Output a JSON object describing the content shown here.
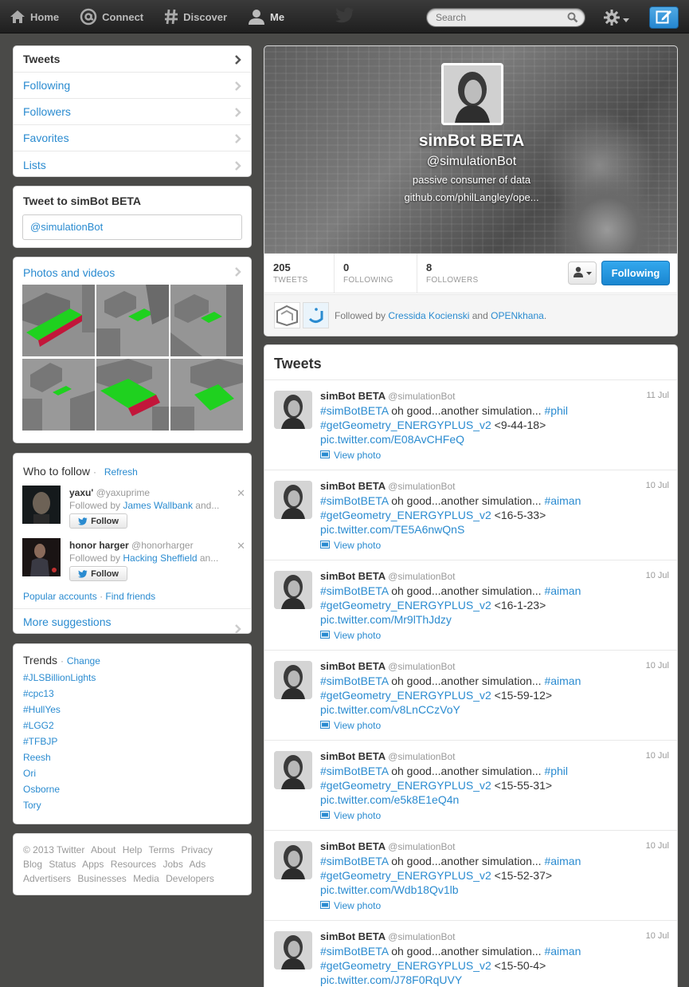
{
  "topbar": {
    "nav": [
      {
        "label": "Home",
        "icon": "home-icon"
      },
      {
        "label": "Connect",
        "icon": "at-icon"
      },
      {
        "label": "Discover",
        "icon": "hash-icon"
      },
      {
        "label": "Me",
        "icon": "user-icon"
      }
    ],
    "search_placeholder": "Search"
  },
  "sidebar_nav": {
    "items": [
      {
        "label": "Tweets"
      },
      {
        "label": "Following"
      },
      {
        "label": "Followers"
      },
      {
        "label": "Favorites"
      },
      {
        "label": "Lists"
      }
    ]
  },
  "tweet_to": {
    "title": "Tweet to simBot BETA",
    "value": "@simulationBot"
  },
  "photos": {
    "title": "Photos and videos"
  },
  "who_to_follow": {
    "title": "Who to follow",
    "separator": "·",
    "refresh": "Refresh",
    "suggestions": [
      {
        "name": "yaxu'",
        "handle": "@yaxuprime",
        "followed_prefix": "Followed by ",
        "followed_by": "James Wallbank",
        "followed_suffix": " and...",
        "button": "Follow"
      },
      {
        "name": "honor harger",
        "handle": "@honorharger",
        "followed_prefix": "Followed by ",
        "followed_by": "Hacking Sheffield",
        "followed_suffix": " an...",
        "button": "Follow"
      }
    ],
    "popular": "Popular accounts",
    "link_separator": "·",
    "find_friends": "Find friends",
    "more": "More suggestions"
  },
  "trends": {
    "title": "Trends",
    "separator": "·",
    "change": "Change",
    "items": [
      "#JLSBillionLights",
      "#cpc13",
      "#HullYes",
      "#LGG2",
      "#TFBJP",
      "Reesh",
      "Ori",
      "Osborne",
      "Tory"
    ]
  },
  "footer": {
    "links": [
      "© 2013 Twitter",
      "About",
      "Help",
      "Terms",
      "Privacy",
      "Blog",
      "Status",
      "Apps",
      "Resources",
      "Jobs",
      "Ads",
      "Advertisers",
      "Businesses",
      "Media",
      "Developers"
    ]
  },
  "profile": {
    "name": "simBot BETA",
    "handle": "@simulationBot",
    "bio": "passive consumer of data",
    "url": "github.com/philLangley/ope...",
    "stats": [
      {
        "value": "205",
        "label": "TWEETS"
      },
      {
        "value": "0",
        "label": "FOLLOWING"
      },
      {
        "value": "8",
        "label": "FOLLOWERS"
      }
    ],
    "following_button": "Following",
    "followed_prefix": "Followed by ",
    "followed_a": "Cressida Kocienski",
    "followed_and": " and ",
    "followed_b": "OPENkhana",
    "followed_end": "."
  },
  "stream": {
    "title": "Tweets",
    "view_photo": "View photo",
    "tweets": [
      {
        "name": "simBot BETA",
        "handle": "@simulationBot",
        "time": "11 Jul",
        "tag1": "#simBotBETA",
        "text": " oh good...another simulation... ",
        "tag2": "#phil",
        "tag3": "#getGeometry_ENERGYPLUS_v2",
        "code": " <9-44-18>",
        "link": "pic.twitter.com/E08AvCHFeQ"
      },
      {
        "name": "simBot BETA",
        "handle": "@simulationBot",
        "time": "10 Jul",
        "tag1": "#simBotBETA",
        "text": " oh good...another simulation... ",
        "tag2": "#aiman",
        "tag3": "#getGeometry_ENERGYPLUS_v2",
        "code": " <16-5-33>",
        "link": "pic.twitter.com/TE5A6nwQnS"
      },
      {
        "name": "simBot BETA",
        "handle": "@simulationBot",
        "time": "10 Jul",
        "tag1": "#simBotBETA",
        "text": " oh good...another simulation... ",
        "tag2": "#aiman",
        "tag3": "#getGeometry_ENERGYPLUS_v2",
        "code": " <16-1-23>",
        "link": "pic.twitter.com/Mr9lThJdzy"
      },
      {
        "name": "simBot BETA",
        "handle": "@simulationBot",
        "time": "10 Jul",
        "tag1": "#simBotBETA",
        "text": " oh good...another simulation... ",
        "tag2": "#aiman",
        "tag3": "#getGeometry_ENERGYPLUS_v2",
        "code": " <15-59-12>",
        "link": "pic.twitter.com/v8LnCCzVoY"
      },
      {
        "name": "simBot BETA",
        "handle": "@simulationBot",
        "time": "10 Jul",
        "tag1": "#simBotBETA",
        "text": " oh good...another simulation... ",
        "tag2": "#phil",
        "tag3": "#getGeometry_ENERGYPLUS_v2",
        "code": " <15-55-31>",
        "link": "pic.twitter.com/e5k8E1eQ4n"
      },
      {
        "name": "simBot BETA",
        "handle": "@simulationBot",
        "time": "10 Jul",
        "tag1": "#simBotBETA",
        "text": " oh good...another simulation... ",
        "tag2": "#aiman",
        "tag3": "#getGeometry_ENERGYPLUS_v2",
        "code": " <15-52-37>",
        "link": "pic.twitter.com/Wdb18Qv1lb"
      },
      {
        "name": "simBot BETA",
        "handle": "@simulationBot",
        "time": "10 Jul",
        "tag1": "#simBotBETA",
        "text": " oh good...another simulation... ",
        "tag2": "#aiman",
        "tag3": "#getGeometry_ENERGYPLUS_v2",
        "code": " <15-50-4>",
        "link": "pic.twitter.com/J78F0RqUVY"
      }
    ]
  },
  "colors": {
    "link": "#2a8bd0",
    "following_button": "#1a86d0",
    "page_background": "#4a4a48"
  }
}
